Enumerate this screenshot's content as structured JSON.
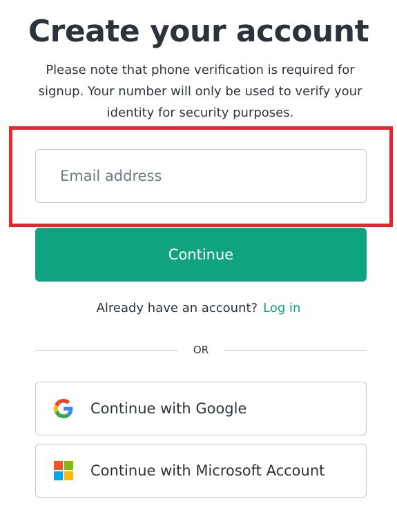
{
  "header": {
    "title": "Create your account",
    "note": "Please note that phone verification is required for signup. Your number will only be used to verify your identity for security purposes."
  },
  "form": {
    "email_placeholder": "Email address",
    "email_value": "",
    "continue_label": "Continue"
  },
  "login": {
    "prompt": "Already have an account?",
    "link_label": "Log in"
  },
  "divider": {
    "label": "OR"
  },
  "social": {
    "google_label": "Continue with Google",
    "google_icon": "google-icon",
    "microsoft_label": "Continue with Microsoft Account",
    "microsoft_icon": "microsoft-icon"
  },
  "colors": {
    "accent": "#10a37f",
    "highlight": "#e8242d",
    "text": "#2d333a",
    "border": "#c2c8d0"
  }
}
